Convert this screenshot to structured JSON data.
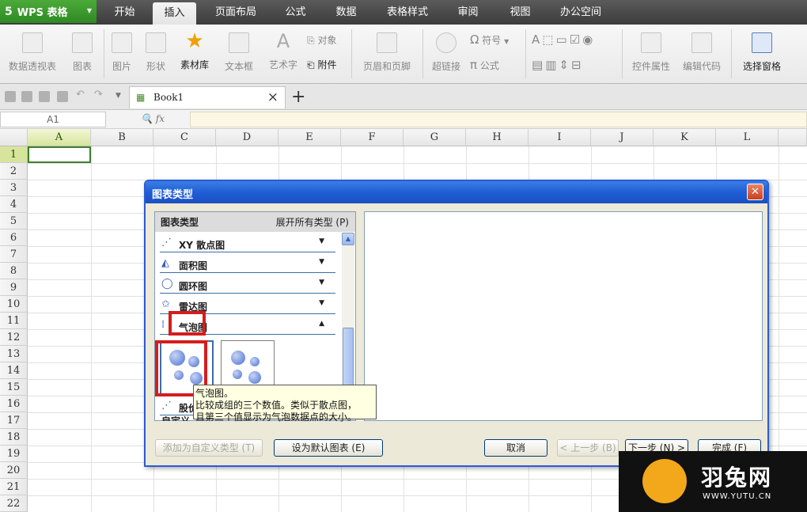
{
  "titlebar": {
    "app_name": "WPS 表格",
    "logo_glyph": "5",
    "menu": [
      "开始",
      "插入",
      "页面布局",
      "公式",
      "数据",
      "表格样式",
      "审阅",
      "视图",
      "办公空间"
    ],
    "active_index": 1
  },
  "ribbon": {
    "pivot": "数据透视表",
    "chart": "图表",
    "picture": "图片",
    "shape": "形状",
    "materials": "素材库",
    "textbox": "文本框",
    "wordart": "艺术字",
    "object": "对象",
    "attachment": "附件",
    "header_footer": "页眉和页脚",
    "hyperlink": "超链接",
    "symbol": "符号",
    "formula": "公式",
    "control_props": "控件属性",
    "edit_code": "编辑代码",
    "select_pane": "选择窗格"
  },
  "tabs": {
    "doc_name": "Book1",
    "close_glyph": "×",
    "new_glyph": "+"
  },
  "formula_bar": {
    "name_box": "A1",
    "fx": "fx"
  },
  "sheet": {
    "columns": [
      "A",
      "B",
      "C",
      "D",
      "E",
      "F",
      "G",
      "H",
      "I",
      "J",
      "K",
      "L"
    ],
    "rows": [
      "1",
      "2",
      "3",
      "4",
      "5",
      "6",
      "7",
      "8",
      "9",
      "10",
      "11",
      "12",
      "13",
      "14",
      "15",
      "16",
      "17",
      "18",
      "19",
      "20",
      "21",
      "22"
    ]
  },
  "dialog": {
    "title": "图表类型",
    "close_glyph": "✕",
    "list_header": "图表类型",
    "expand_all": "展开所有类型 (P)",
    "categories": [
      {
        "label": "XY 散点图",
        "icon": "⋰"
      },
      {
        "label": "面积图",
        "icon": "◭"
      },
      {
        "label": "圆环图",
        "icon": "◯"
      },
      {
        "label": "雷达图",
        "icon": "✩"
      },
      {
        "label": "气泡图",
        "icon": "⁞"
      },
      {
        "label": "股价",
        "icon": "⋰"
      }
    ],
    "partial_label": "自定义",
    "tooltip_line1": "气泡图。",
    "tooltip_line2": "比较成组的三个数值。类似于散点图，",
    "tooltip_line3": "且第三个值显示为气泡数据点的大小。",
    "btn_add_custom": "添加为自定义类型 (T)",
    "btn_set_default": "设为默认图表 (E)",
    "btn_cancel": "取消",
    "btn_prev": "< 上一步 (B)",
    "btn_next": "下一步 (N) >",
    "btn_finish": "完成 (F)"
  },
  "watermark": {
    "name": "羽兔网",
    "url": "WWW.YUTU.CN"
  }
}
